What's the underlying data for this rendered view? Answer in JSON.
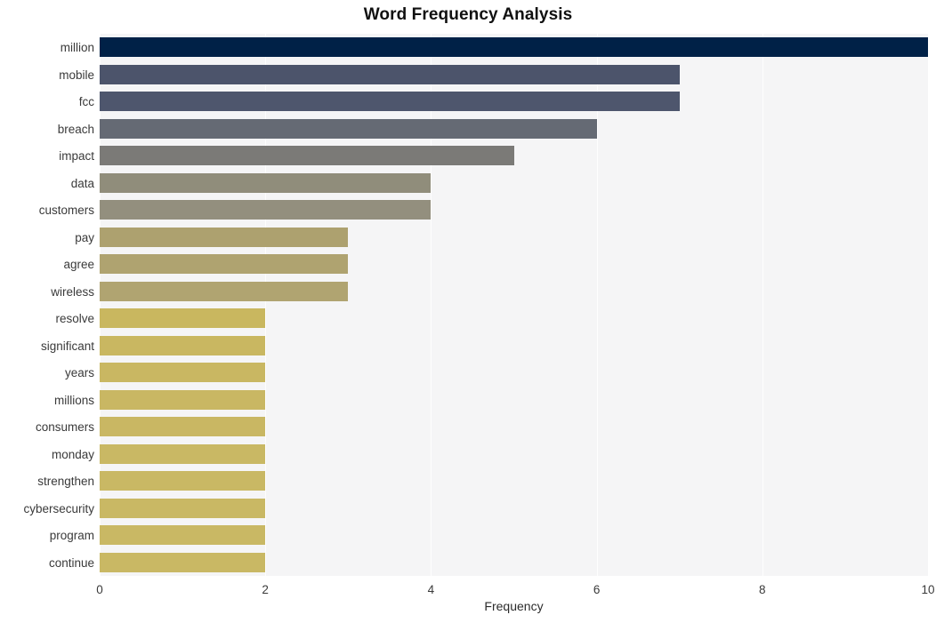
{
  "chart_data": {
    "type": "bar",
    "orientation": "horizontal",
    "title": "Word Frequency Analysis",
    "xlabel": "Frequency",
    "ylabel": "",
    "xlim": [
      0,
      10
    ],
    "xticks": [
      0,
      2,
      4,
      6,
      8,
      10
    ],
    "xtick_labels": [
      "0",
      "2",
      "4",
      "6",
      "8",
      "10"
    ],
    "grid": true,
    "grid_axis": "x",
    "legend": false,
    "plot_background": "#f5f5f6",
    "figure_background": "#ffffff",
    "categories": [
      "million",
      "mobile",
      "fcc",
      "breach",
      "impact",
      "data",
      "customers",
      "pay",
      "agree",
      "wireless",
      "resolve",
      "significant",
      "years",
      "millions",
      "consumers",
      "monday",
      "strengthen",
      "cybersecurity",
      "program",
      "continue"
    ],
    "values": [
      10,
      7,
      7,
      6,
      5,
      4,
      4,
      3,
      3,
      3,
      2,
      2,
      2,
      2,
      2,
      2,
      2,
      2,
      2,
      2
    ],
    "bar_colors": [
      "#002147",
      "#4c546b",
      "#4e566d",
      "#656a74",
      "#7b7a77",
      "#908d7b",
      "#938f7e",
      "#ada16f",
      "#afa370",
      "#b0a471",
      "#c9b75f",
      "#c9b761",
      "#c9b762",
      "#c9b763",
      "#c9b763",
      "#c9b864",
      "#c9b864",
      "#c9b864",
      "#c9b864",
      "#c9b864"
    ]
  }
}
